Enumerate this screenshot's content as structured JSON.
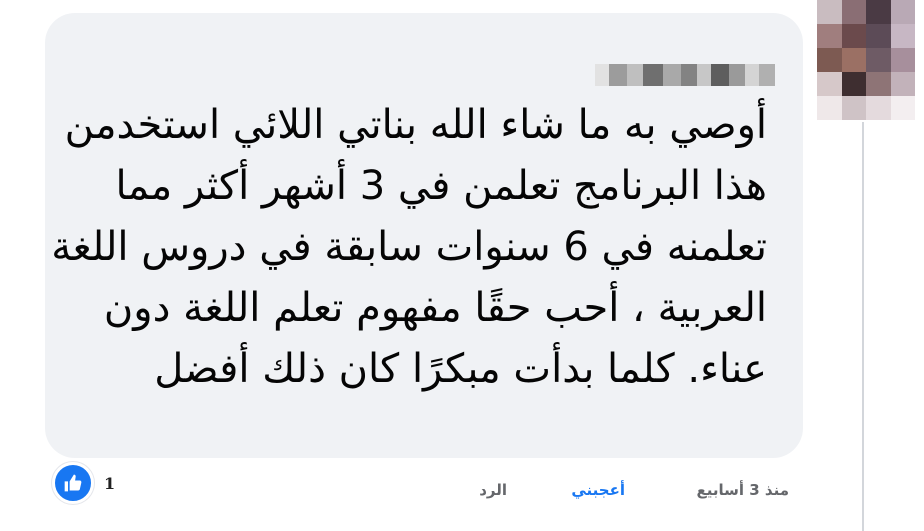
{
  "comment": {
    "text_lines": [
      "أوصي به ما شاء الله بناتي اللائي استخدمن",
      "هذا البرنامج تعلمن في 3 أشهر أكثر مما",
      "تعلمنه في 6 سنوات سابقة في دروس اللغة",
      "العربية ، أحب حقًا مفهوم تعلم اللغة دون",
      "عناء. كلما بدأت مبكرًا كان ذلك أفضل"
    ]
  },
  "reactions": {
    "count": "1",
    "icon": "thumbs-up-icon",
    "color": "#1877f2"
  },
  "actions": {
    "timestamp": "منذ 3 أسابيع",
    "like_label": "أعجبني",
    "reply_label": "الرد"
  },
  "colors": {
    "bubble": "#f0f2f5",
    "text": "#050505",
    "link_blue": "#1877f2",
    "muted": "#65676b"
  }
}
